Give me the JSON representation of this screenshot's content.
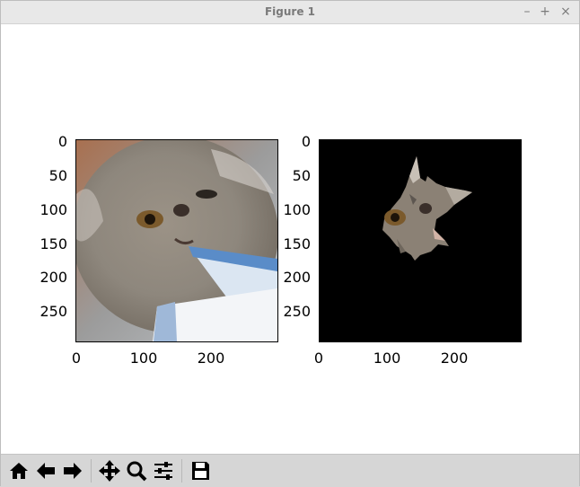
{
  "window": {
    "title": "Figure 1"
  },
  "window_buttons": {
    "minimize": "–",
    "maximize": "+",
    "close": "×"
  },
  "figure": {
    "left_axes": {
      "image": "cat photo (kitten chewing paper)",
      "yticks": [
        "0",
        "50",
        "100",
        "150",
        "200",
        "250"
      ],
      "xticks": [
        "0",
        "100",
        "200"
      ]
    },
    "right_axes": {
      "image": "masked cat face on black background",
      "yticks": [
        "0",
        "50",
        "100",
        "150",
        "200",
        "250"
      ],
      "xticks": [
        "0",
        "100",
        "200"
      ]
    }
  },
  "toolbar": {
    "buttons": [
      "home-icon",
      "back-icon",
      "forward-icon",
      "pan-icon",
      "zoom-icon",
      "configure-subplots-icon",
      "save-icon"
    ]
  }
}
